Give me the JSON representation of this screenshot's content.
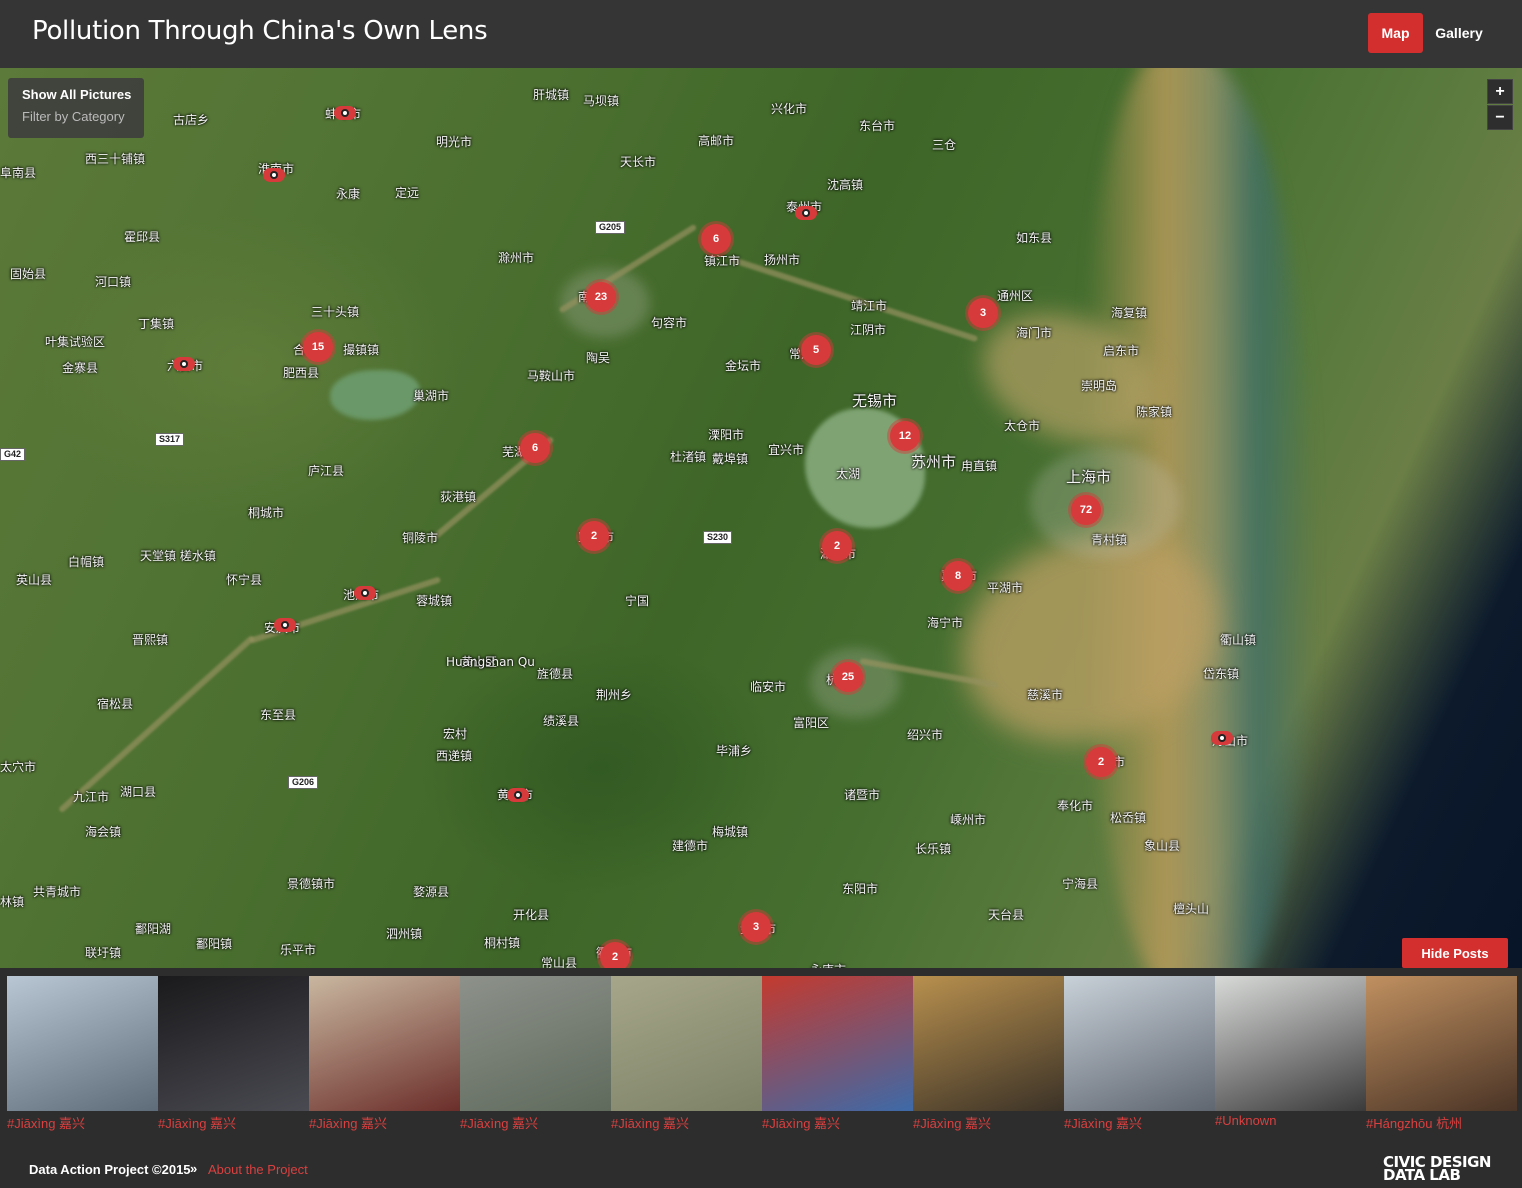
{
  "header": {
    "title": "Pollution Through China's Own Lens",
    "nav_map": "Map",
    "nav_gallery": "Gallery"
  },
  "filter": {
    "show_all": "Show All Pictures",
    "by_category": "Filter by Category"
  },
  "zoom": {
    "in": "+",
    "out": "−"
  },
  "map": {
    "labels": [
      "古店乡",
      "西三十铺镇",
      "阜南县",
      "淮南市",
      "蚌埠市",
      "肝城镇",
      "马坝镇",
      "明光市",
      "兴化市",
      "东台市",
      "三仓",
      "高邮市",
      "天长市",
      "永康",
      "定远",
      "沈高镇",
      "霍邱县",
      "泰州市",
      "扬州市",
      "G205",
      "滁州市",
      "如东县",
      "镇江市",
      "固始县",
      "河口镇",
      "南京市",
      "句容市",
      "通州区",
      "海复镇",
      "丁集镇",
      "三十头镇",
      "靖江市",
      "海门市",
      "叶集试验区",
      "合肥市",
      "撮镇镇",
      "江阴市",
      "常州市",
      "启东市",
      "金寨县",
      "六安市",
      "肥西县",
      "陶吴",
      "马鞍山市",
      "金坛市",
      "崇明岛",
      "巢湖市",
      "无锡市",
      "陈家镇",
      "S317",
      "溧阳市",
      "G42",
      "芜湖市",
      "宜兴市",
      "太仓市",
      "杜渚镇",
      "戴埠镇",
      "太湖",
      "苏州市",
      "甪直镇",
      "上海市",
      "庐江县",
      "荻港镇",
      "桐城市",
      "S230",
      "青村镇",
      "宣城市",
      "湖州市",
      "铜陵市",
      "天堂镇 槎水镇",
      "白帽镇",
      "平湖市",
      "嘉兴市",
      "英山县",
      "怀宁县",
      "池州市",
      "蓉城镇",
      "宁国",
      "海宁市",
      "安庆市",
      "衢山镇",
      "晋熙镇",
      "黄山区",
      "旌德县",
      "临安市",
      "杭州市",
      "岱东镇",
      "荆州乡",
      "慈溪市",
      "宿松县",
      "东至县",
      "绩溪县",
      "富阳区",
      "宏村",
      "西递镇",
      "毕浦乡",
      "绍兴市",
      "宁波市",
      "舟山市",
      "太穴市",
      "G206",
      "黄山市",
      "九江市",
      "湖口县",
      "诸暨市",
      "奉化市",
      "松岙镇",
      "嵊州市",
      "海会镇",
      "梅城镇",
      "象山县",
      "建德市",
      "长乐镇",
      "共青城市",
      "景德镇市",
      "婺源县",
      "东阳市",
      "宁海县",
      "林镇",
      "开化县",
      "天台县",
      "檀头山",
      "鄱阳湖",
      "鄱阳镇",
      "泗州镇",
      "桐村镇",
      "金华市",
      "联圩镇",
      "乐平市",
      "衢州市",
      "常山县",
      "永康市"
    ],
    "special_label": "Huangshan Qu",
    "clusters": [
      6,
      23,
      15,
      3,
      5,
      6,
      12,
      72,
      2,
      2,
      8,
      25,
      2,
      3,
      2
    ],
    "single_pins": [
      "蚌埠市",
      "淮南市",
      "泰州市",
      "六安市",
      "池州市",
      "安庆市",
      "黄山市",
      "舟山市"
    ]
  },
  "hide_posts": "Hide Posts",
  "gallery": [
    {
      "caption": "#Jiāxìng 嘉兴",
      "colors": [
        "#b9c6d4",
        "#5e6c7a"
      ]
    },
    {
      "caption": "#Jiāxìng 嘉兴",
      "colors": [
        "#1a1a1c",
        "#4a4a52"
      ]
    },
    {
      "caption": "#Jiāxìng 嘉兴",
      "colors": [
        "#c9b7a0",
        "#6b2e2a"
      ]
    },
    {
      "caption": "#Jiāxìng 嘉兴",
      "colors": [
        "#8d918a",
        "#5f6a5c"
      ]
    },
    {
      "caption": "#Jiāxìng 嘉兴",
      "colors": [
        "#a6a68a",
        "#7d8266"
      ]
    },
    {
      "caption": "#Jiāxìng 嘉兴",
      "colors": [
        "#c43a2e",
        "#3d6aa8"
      ]
    },
    {
      "caption": "#Jiāxìng 嘉兴",
      "colors": [
        "#b8904e",
        "#3b3227"
      ]
    },
    {
      "caption": "#Jiāxìng 嘉兴",
      "colors": [
        "#c8d0d8",
        "#5f6670"
      ]
    },
    {
      "caption": "#Unknown",
      "colors": [
        "#d8dad8",
        "#3a3a3a"
      ]
    },
    {
      "caption": "#Hángzhōu 杭州",
      "colors": [
        "#c09060",
        "#4a3426"
      ]
    }
  ],
  "footer": {
    "copyright": "Data Action Project ©2015",
    "separator": "»",
    "about": "About the Project",
    "logo_line1": "CIVIC DESIGN",
    "logo_line2": "DATA LAB"
  }
}
